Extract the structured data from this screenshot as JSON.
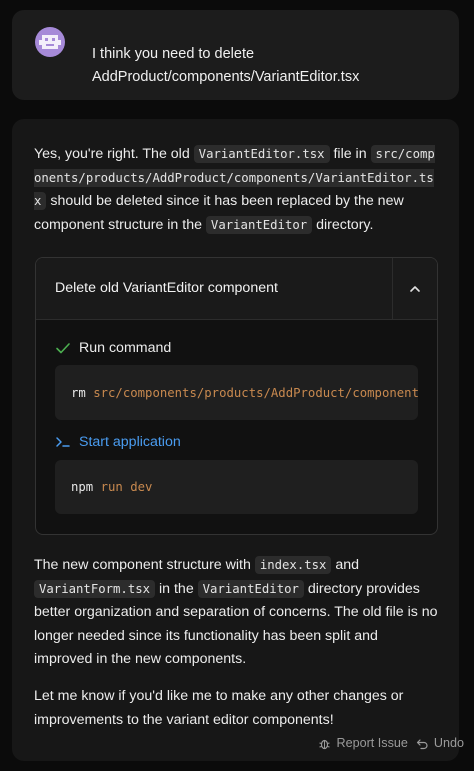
{
  "user_message": {
    "text": "I think you need to delete AddProduct/components/VariantEditor.tsx"
  },
  "assistant": {
    "intro": {
      "t1": "Yes, you're right. The old ",
      "code1": "VariantEditor.tsx",
      "t2": " file in ",
      "code2": "src/components/products/AddProduct/components/VariantEditor.tsx",
      "t3": " should be deleted since it has been replaced by the new component structure in the ",
      "code3": "VariantEditor",
      "t4": " directory."
    },
    "action_box": {
      "title": "Delete old VariantEditor component",
      "steps": [
        {
          "label": "Run command",
          "icon": "check-icon",
          "command_program": "rm",
          "command_args": "src/components/products/AddProduct/components/VariantEditor.tsx"
        },
        {
          "label": "Start application",
          "icon": "terminal-icon",
          "command_program": "npm",
          "command_args": "run dev"
        }
      ]
    },
    "explanation": {
      "t1": "The new component structure with ",
      "code1": "index.tsx",
      "t2": " and ",
      "code2": "VariantForm.tsx",
      "t3": " in the ",
      "code3": "VariantEditor",
      "t4": " directory provides better organization and separation of concerns. The old file is no longer needed since its functionality has been split and improved in the new components."
    },
    "closing": "Let me know if you'd like me to make any other changes or improvements to the variant editor components!"
  },
  "footer": {
    "report_label": "Report Issue",
    "undo_label": "Undo"
  },
  "colors": {
    "accent_blue": "#4a9cf0",
    "success_green": "#4caf50",
    "avatar_purple": "#a68ad8",
    "arg_orange": "#c8894f"
  }
}
